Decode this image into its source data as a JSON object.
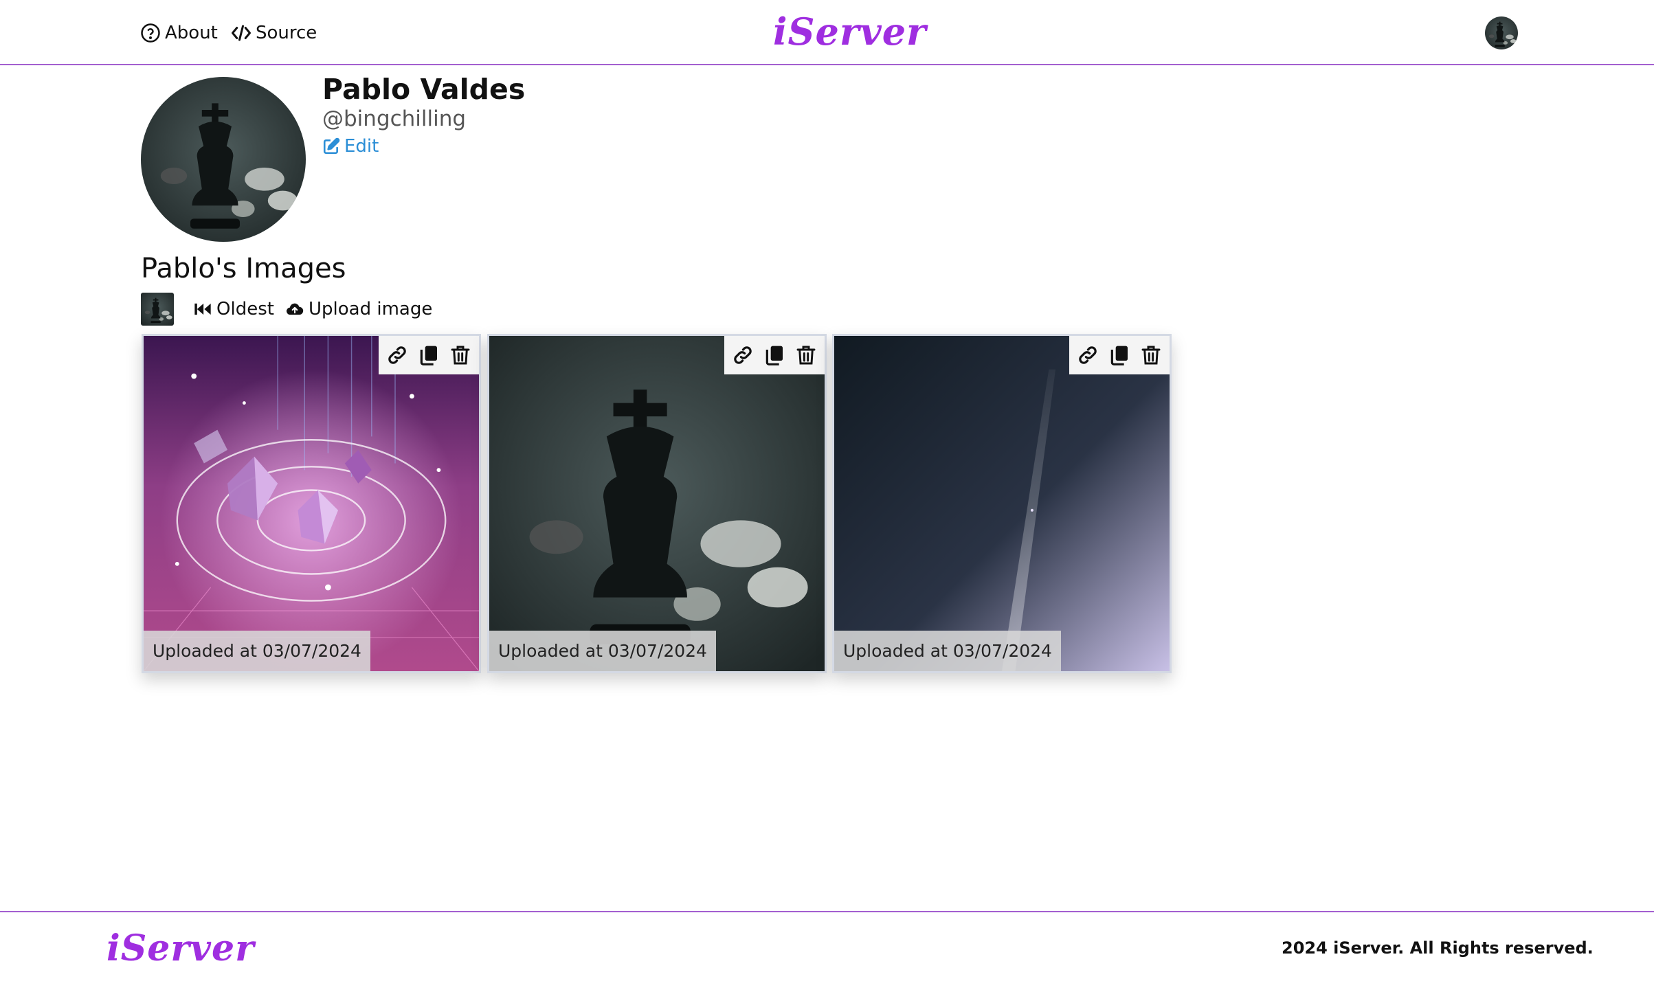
{
  "header": {
    "nav": [
      {
        "label": "About",
        "icon": "question-circle-icon"
      },
      {
        "label": "Source",
        "icon": "code-icon"
      }
    ],
    "brand": "iServer",
    "account_icon": "user-avatar"
  },
  "profile": {
    "name": "Pablo Valdes",
    "handle": "@bingchilling",
    "edit_label": "Edit"
  },
  "gallery": {
    "title": "Pablo's Images",
    "sort_label": "Oldest",
    "upload_label": "Upload image",
    "images": [
      {
        "caption": "Uploaded at 03/07/2024",
        "subject": "abstract purple crystals",
        "actions": [
          "link-icon",
          "copy-icon",
          "trash-icon"
        ]
      },
      {
        "caption": "Uploaded at 03/07/2024",
        "subject": "black chess king",
        "actions": [
          "link-icon",
          "copy-icon",
          "trash-icon"
        ]
      },
      {
        "caption": "Uploaded at 03/07/2024",
        "subject": "dark space sky",
        "actions": [
          "link-icon",
          "copy-icon",
          "trash-icon"
        ]
      }
    ]
  },
  "footer": {
    "brand": "iServer",
    "copyright": "2024 iServer. All Rights reserved."
  },
  "colors": {
    "accent": "#a35fd0",
    "brand": "#9f2ee0",
    "link": "#2b8ed6"
  }
}
